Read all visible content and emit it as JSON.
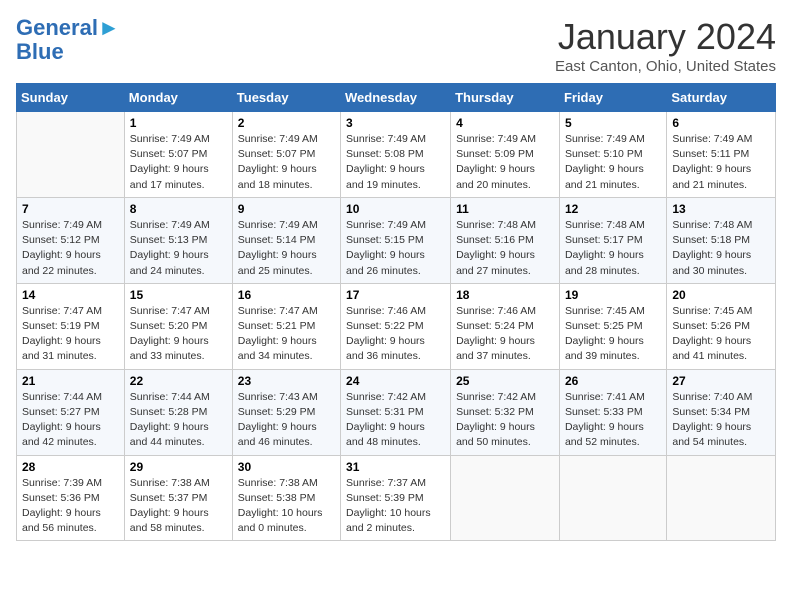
{
  "header": {
    "logo": {
      "line1": "General",
      "line2": "Blue"
    },
    "month": "January 2024",
    "location": "East Canton, Ohio, United States"
  },
  "days_of_week": [
    "Sunday",
    "Monday",
    "Tuesday",
    "Wednesday",
    "Thursday",
    "Friday",
    "Saturday"
  ],
  "weeks": [
    [
      {
        "day": "",
        "sunrise": "",
        "sunset": "",
        "daylight": ""
      },
      {
        "day": "1",
        "sunrise": "Sunrise: 7:49 AM",
        "sunset": "Sunset: 5:07 PM",
        "daylight": "Daylight: 9 hours and 17 minutes."
      },
      {
        "day": "2",
        "sunrise": "Sunrise: 7:49 AM",
        "sunset": "Sunset: 5:07 PM",
        "daylight": "Daylight: 9 hours and 18 minutes."
      },
      {
        "day": "3",
        "sunrise": "Sunrise: 7:49 AM",
        "sunset": "Sunset: 5:08 PM",
        "daylight": "Daylight: 9 hours and 19 minutes."
      },
      {
        "day": "4",
        "sunrise": "Sunrise: 7:49 AM",
        "sunset": "Sunset: 5:09 PM",
        "daylight": "Daylight: 9 hours and 20 minutes."
      },
      {
        "day": "5",
        "sunrise": "Sunrise: 7:49 AM",
        "sunset": "Sunset: 5:10 PM",
        "daylight": "Daylight: 9 hours and 21 minutes."
      },
      {
        "day": "6",
        "sunrise": "Sunrise: 7:49 AM",
        "sunset": "Sunset: 5:11 PM",
        "daylight": "Daylight: 9 hours and 21 minutes."
      }
    ],
    [
      {
        "day": "7",
        "sunrise": "Sunrise: 7:49 AM",
        "sunset": "Sunset: 5:12 PM",
        "daylight": "Daylight: 9 hours and 22 minutes."
      },
      {
        "day": "8",
        "sunrise": "Sunrise: 7:49 AM",
        "sunset": "Sunset: 5:13 PM",
        "daylight": "Daylight: 9 hours and 24 minutes."
      },
      {
        "day": "9",
        "sunrise": "Sunrise: 7:49 AM",
        "sunset": "Sunset: 5:14 PM",
        "daylight": "Daylight: 9 hours and 25 minutes."
      },
      {
        "day": "10",
        "sunrise": "Sunrise: 7:49 AM",
        "sunset": "Sunset: 5:15 PM",
        "daylight": "Daylight: 9 hours and 26 minutes."
      },
      {
        "day": "11",
        "sunrise": "Sunrise: 7:48 AM",
        "sunset": "Sunset: 5:16 PM",
        "daylight": "Daylight: 9 hours and 27 minutes."
      },
      {
        "day": "12",
        "sunrise": "Sunrise: 7:48 AM",
        "sunset": "Sunset: 5:17 PM",
        "daylight": "Daylight: 9 hours and 28 minutes."
      },
      {
        "day": "13",
        "sunrise": "Sunrise: 7:48 AM",
        "sunset": "Sunset: 5:18 PM",
        "daylight": "Daylight: 9 hours and 30 minutes."
      }
    ],
    [
      {
        "day": "14",
        "sunrise": "Sunrise: 7:47 AM",
        "sunset": "Sunset: 5:19 PM",
        "daylight": "Daylight: 9 hours and 31 minutes."
      },
      {
        "day": "15",
        "sunrise": "Sunrise: 7:47 AM",
        "sunset": "Sunset: 5:20 PM",
        "daylight": "Daylight: 9 hours and 33 minutes."
      },
      {
        "day": "16",
        "sunrise": "Sunrise: 7:47 AM",
        "sunset": "Sunset: 5:21 PM",
        "daylight": "Daylight: 9 hours and 34 minutes."
      },
      {
        "day": "17",
        "sunrise": "Sunrise: 7:46 AM",
        "sunset": "Sunset: 5:22 PM",
        "daylight": "Daylight: 9 hours and 36 minutes."
      },
      {
        "day": "18",
        "sunrise": "Sunrise: 7:46 AM",
        "sunset": "Sunset: 5:24 PM",
        "daylight": "Daylight: 9 hours and 37 minutes."
      },
      {
        "day": "19",
        "sunrise": "Sunrise: 7:45 AM",
        "sunset": "Sunset: 5:25 PM",
        "daylight": "Daylight: 9 hours and 39 minutes."
      },
      {
        "day": "20",
        "sunrise": "Sunrise: 7:45 AM",
        "sunset": "Sunset: 5:26 PM",
        "daylight": "Daylight: 9 hours and 41 minutes."
      }
    ],
    [
      {
        "day": "21",
        "sunrise": "Sunrise: 7:44 AM",
        "sunset": "Sunset: 5:27 PM",
        "daylight": "Daylight: 9 hours and 42 minutes."
      },
      {
        "day": "22",
        "sunrise": "Sunrise: 7:44 AM",
        "sunset": "Sunset: 5:28 PM",
        "daylight": "Daylight: 9 hours and 44 minutes."
      },
      {
        "day": "23",
        "sunrise": "Sunrise: 7:43 AM",
        "sunset": "Sunset: 5:29 PM",
        "daylight": "Daylight: 9 hours and 46 minutes."
      },
      {
        "day": "24",
        "sunrise": "Sunrise: 7:42 AM",
        "sunset": "Sunset: 5:31 PM",
        "daylight": "Daylight: 9 hours and 48 minutes."
      },
      {
        "day": "25",
        "sunrise": "Sunrise: 7:42 AM",
        "sunset": "Sunset: 5:32 PM",
        "daylight": "Daylight: 9 hours and 50 minutes."
      },
      {
        "day": "26",
        "sunrise": "Sunrise: 7:41 AM",
        "sunset": "Sunset: 5:33 PM",
        "daylight": "Daylight: 9 hours and 52 minutes."
      },
      {
        "day": "27",
        "sunrise": "Sunrise: 7:40 AM",
        "sunset": "Sunset: 5:34 PM",
        "daylight": "Daylight: 9 hours and 54 minutes."
      }
    ],
    [
      {
        "day": "28",
        "sunrise": "Sunrise: 7:39 AM",
        "sunset": "Sunset: 5:36 PM",
        "daylight": "Daylight: 9 hours and 56 minutes."
      },
      {
        "day": "29",
        "sunrise": "Sunrise: 7:38 AM",
        "sunset": "Sunset: 5:37 PM",
        "daylight": "Daylight: 9 hours and 58 minutes."
      },
      {
        "day": "30",
        "sunrise": "Sunrise: 7:38 AM",
        "sunset": "Sunset: 5:38 PM",
        "daylight": "Daylight: 10 hours and 0 minutes."
      },
      {
        "day": "31",
        "sunrise": "Sunrise: 7:37 AM",
        "sunset": "Sunset: 5:39 PM",
        "daylight": "Daylight: 10 hours and 2 minutes."
      },
      {
        "day": "",
        "sunrise": "",
        "sunset": "",
        "daylight": ""
      },
      {
        "day": "",
        "sunrise": "",
        "sunset": "",
        "daylight": ""
      },
      {
        "day": "",
        "sunrise": "",
        "sunset": "",
        "daylight": ""
      }
    ]
  ]
}
